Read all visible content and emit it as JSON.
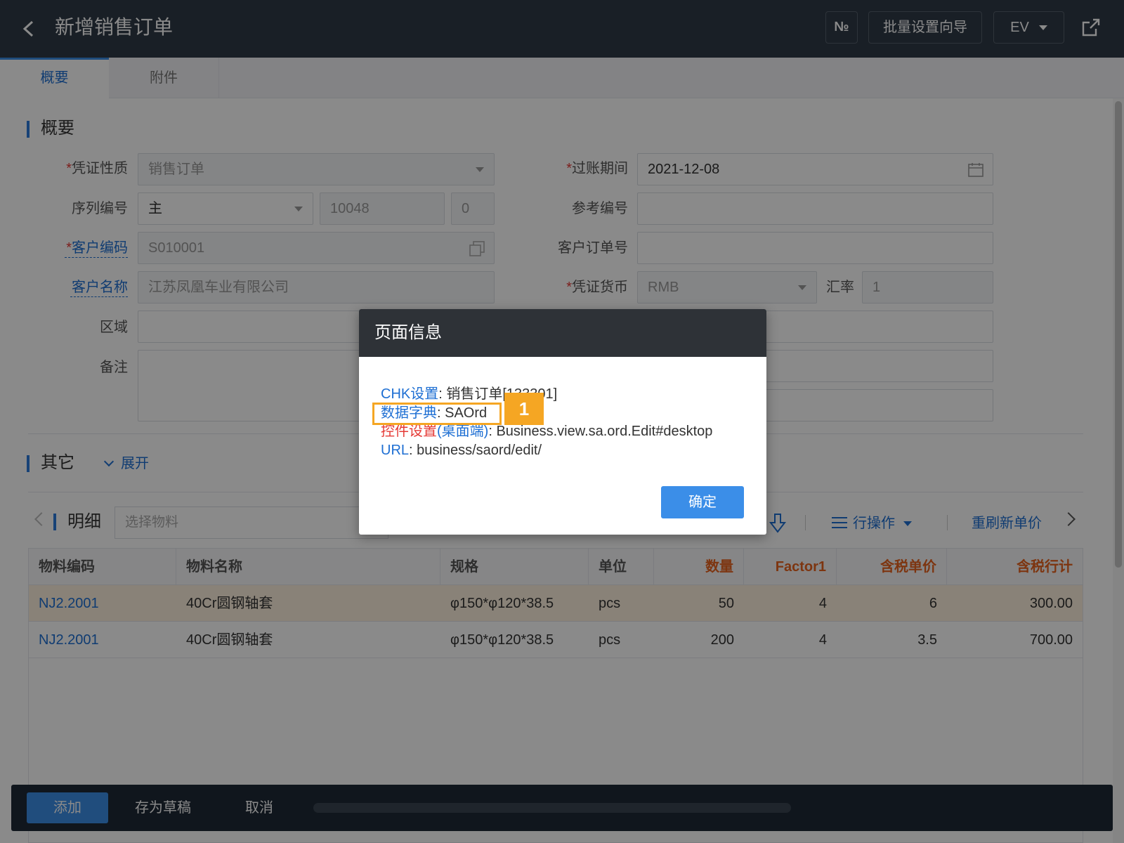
{
  "header": {
    "title": "新增销售订单",
    "no_label": "№",
    "wizard_label": "批量设置向导",
    "ev_label": "EV"
  },
  "tabs": [
    {
      "label": "概要"
    },
    {
      "label": "附件"
    }
  ],
  "summary": {
    "section_title": "概要",
    "voucher_type": {
      "label": "凭证性质",
      "value": "销售订单"
    },
    "post_period": {
      "label": "过账期间",
      "value": "2021-12-08"
    },
    "serial": {
      "label": "序列编号",
      "prefix": "主",
      "number": "10048",
      "suffix": "0"
    },
    "reference_no": {
      "label": "参考编号",
      "value": ""
    },
    "customer_code": {
      "label": "客户编码",
      "value": "S010001"
    },
    "customer_order_no": {
      "label": "客户订单号",
      "value": ""
    },
    "customer_name": {
      "label": "客户名称",
      "value": "江苏凤凰车业有限公司"
    },
    "currency": {
      "label": "凭证货币",
      "value": "RMB"
    },
    "exchange_rate": {
      "label": "汇率",
      "value": "1"
    },
    "region": {
      "label": "区域",
      "value": ""
    },
    "remark": {
      "label": "备注",
      "value": ""
    }
  },
  "other": {
    "section_title": "其它",
    "expand_label": "展开"
  },
  "detail": {
    "title": "明细",
    "search_placeholder": "选择物料",
    "row_ops_label": "行操作",
    "reprice_label": "重刷新单价",
    "columns": [
      "物料编码",
      "物料名称",
      "规格",
      "单位",
      "数量",
      "Factor1",
      "含税单价",
      "含税行计"
    ],
    "rows": [
      {
        "code": "NJ2.2001",
        "name": "40Cr圆钢轴套",
        "spec": "φ150*φ120*38.5",
        "unit": "pcs",
        "qty": "50",
        "factor": "4",
        "price": "6",
        "total": "300.00"
      },
      {
        "code": "NJ2.2001",
        "name": "40Cr圆钢轴套",
        "spec": "φ150*φ120*38.5",
        "unit": "pcs",
        "qty": "200",
        "factor": "4",
        "price": "3.5",
        "total": "700.00"
      }
    ]
  },
  "footer": {
    "add_label": "添加",
    "draft_label": "存为草稿",
    "cancel_label": "取消"
  },
  "dialog": {
    "title": "页面信息",
    "chk_key": "CHK设置",
    "chk_value": "销售订单[133301]",
    "dict_key": "数据字典",
    "dict_value": "SAOrd",
    "ctrl_key_red": "控件设置",
    "ctrl_key_blue": "(桌面端)",
    "ctrl_value": "Business.view.sa.ord.Edit#desktop",
    "url_key": "URL",
    "url_value": "business/saord/edit/",
    "badge": "1",
    "ok_label": "确定"
  },
  "colors": {
    "accent": "#3b8ee8",
    "header_bg": "#2f3a47",
    "highlight": "#f5a623",
    "required": "#e53935",
    "column_emphasis": "#e8631e"
  }
}
